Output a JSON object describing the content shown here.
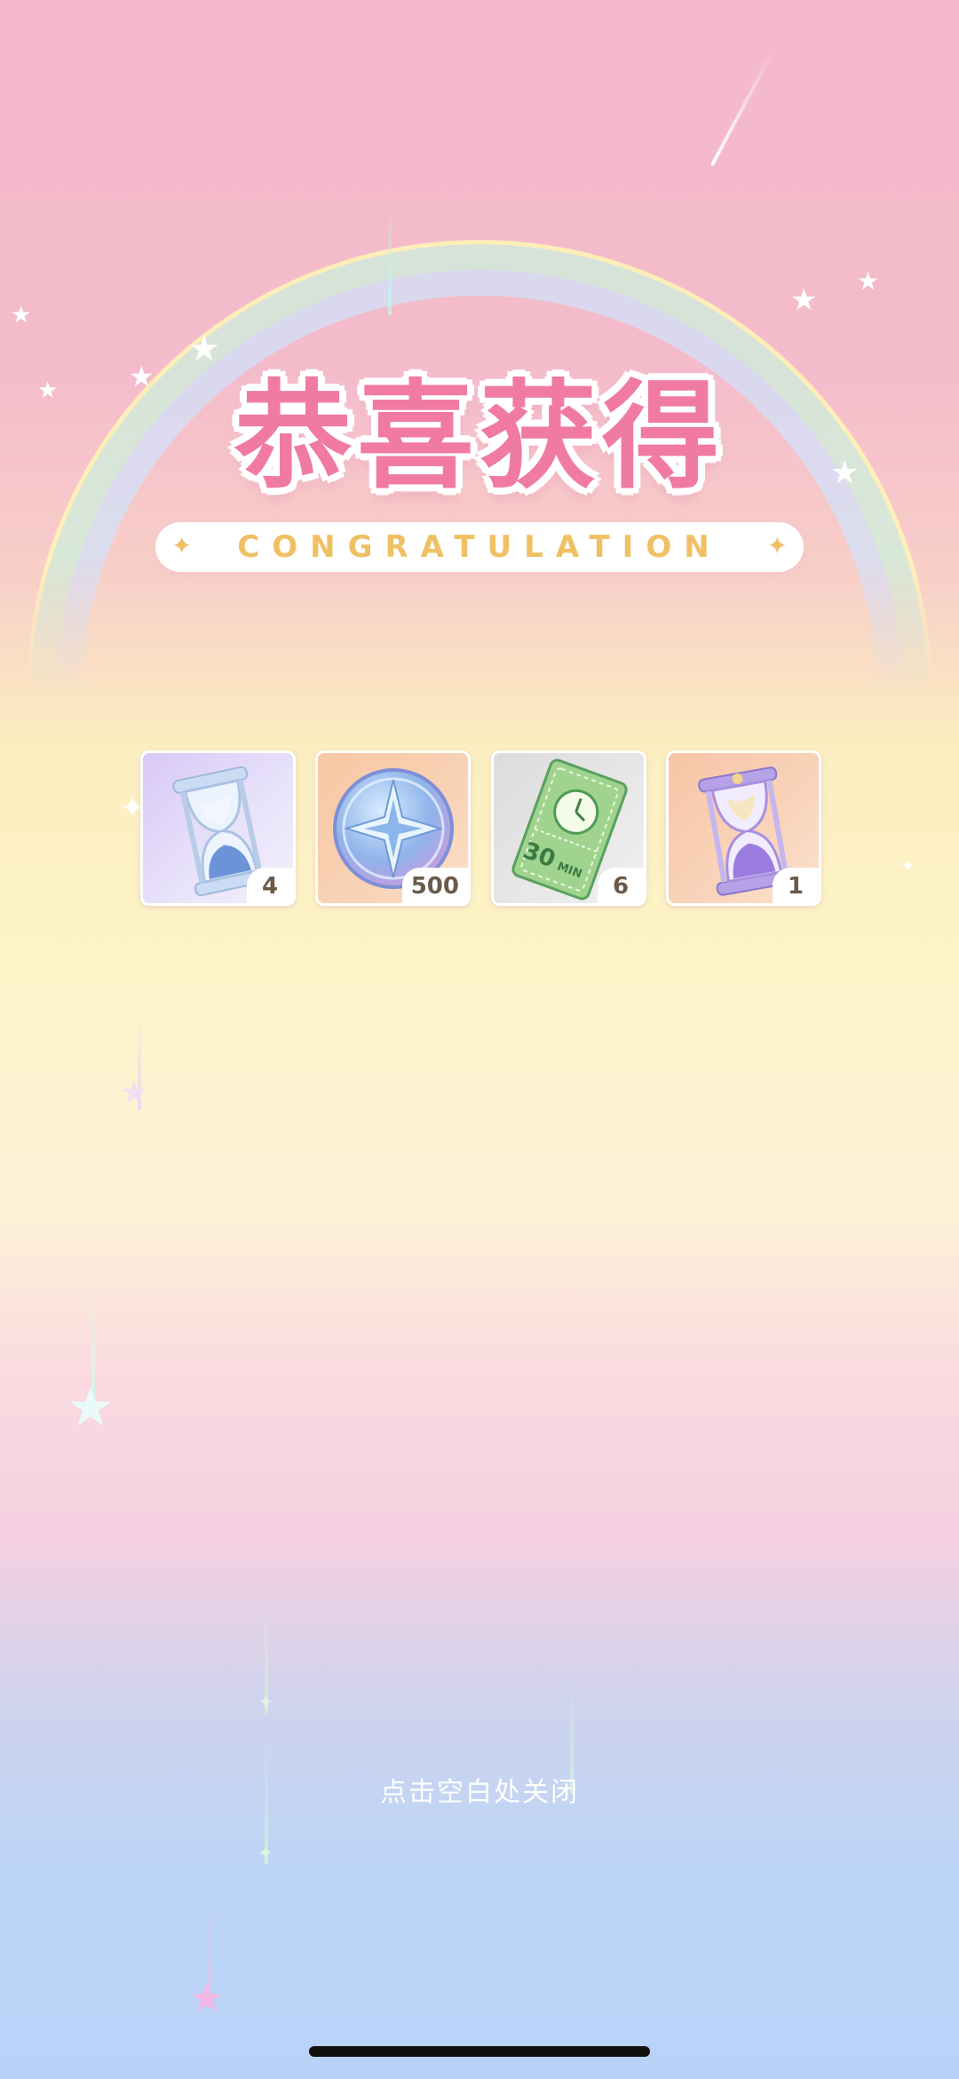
{
  "title": "恭喜获得",
  "subtitle": "CONGRATULATION",
  "rewards": [
    {
      "name": "blue-hourglass",
      "quantity": "4"
    },
    {
      "name": "star-coin",
      "quantity": "500"
    },
    {
      "name": "time-ticket",
      "quantity": "6",
      "ticket_label": "30",
      "ticket_unit": "MIN"
    },
    {
      "name": "purple-hourglass",
      "quantity": "1"
    }
  ],
  "hint": "点击空白处关闭",
  "colors": {
    "title": "#f07aa2",
    "accent": "#f0c064"
  }
}
